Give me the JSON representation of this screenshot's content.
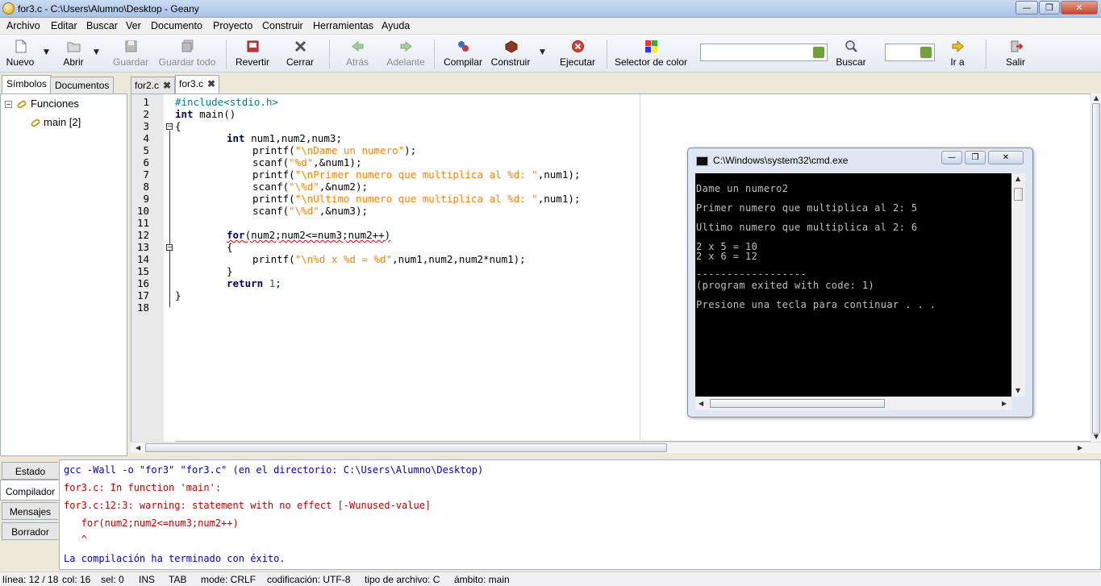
{
  "window": {
    "title": "for3.c - C:\\Users\\Alumno\\Desktop - Geany"
  },
  "menu": [
    "Archivo",
    "Editar",
    "Buscar",
    "Ver",
    "Documento",
    "Proyecto",
    "Construir",
    "Herramientas",
    "Ayuda"
  ],
  "toolbar": {
    "nuevo": "Nuevo",
    "abrir": "Abrir",
    "guardar": "Guardar",
    "guardar_todo": "Guardar todo",
    "revertir": "Revertir",
    "cerrar": "Cerrar",
    "atras": "Atrás",
    "adelante": "Adelante",
    "compilar": "Compilar",
    "construir": "Construir",
    "ejecutar": "Ejecutar",
    "selector_color": "Selector de color",
    "buscar": "Buscar",
    "ir_a": "Ir a",
    "salir": "Salir"
  },
  "sidebar": {
    "tabs": [
      "Símbolos",
      "Documentos"
    ],
    "tree": {
      "root": "Funciones",
      "child": "main [2]"
    }
  },
  "documents": [
    "for2.c",
    "for3.c"
  ],
  "editor": {
    "line_numbers": [
      "1",
      "2",
      "3",
      "4",
      "5",
      "6",
      "7",
      "8",
      "9",
      "10",
      "11",
      "12",
      "13",
      "14",
      "15",
      "16",
      "17",
      "18"
    ],
    "lines": {
      "l1": "#include<stdio.h>",
      "l2_kw": "int",
      "l2_rest": " main()",
      "l3": "{",
      "l4_kw": "int",
      "l4_rest": " num1,num2,num3;",
      "l5_a": "printf(",
      "l5_s": "\"\\nDame un numero\"",
      "l5_b": ");",
      "l6_a": "scanf(",
      "l6_s": "\"%d\"",
      "l6_b": ",&num1);",
      "l7_a": "printf(",
      "l7_s": "\"\\nPrimer numero que multiplica al %d: \"",
      "l7_b": ",num1);",
      "l8_a": "scanf(",
      "l8_s": "\"\\%d\"",
      "l8_b": ",&num2);",
      "l9_a": "printf(",
      "l9_s": "\"\\nUltimo numero que multiplica al %d: \"",
      "l9_b": ",num1);",
      "l10_a": "scanf(",
      "l10_s": "\"\\%d\"",
      "l10_b": ",&num3);",
      "l12_kw": "for",
      "l12_rest": "(num2;num2<=num3;num2++)",
      "l13": "{",
      "l14_a": "printf(",
      "l14_s": "\"\\n%d x %d = %d\"",
      "l14_b": ",num1,num2,num2*num1);",
      "l15": "}",
      "l16_kw": "return",
      "l16_num": "1",
      "l16_end": ";",
      "l17": "}"
    }
  },
  "console": {
    "title": "C:\\Windows\\system32\\cmd.exe",
    "lines": [
      "Dame un numero2",
      "Primer numero que multiplica al 2: 5",
      "Ultimo numero que multiplica al 2: 6",
      "2 x 5 = 10",
      "2 x 6 = 12",
      "------------------",
      "(program exited with code: 1)",
      "Presione una tecla para continuar . . ."
    ]
  },
  "bottom_tabs": [
    "Estado",
    "Compilador",
    "Mensajes",
    "Borrador"
  ],
  "compiler": {
    "cmd": "gcc -Wall -o \"for3\" \"for3.c\" (en el directorio: C:\\Users\\Alumno\\Desktop)",
    "l1": "for3.c: In function 'main':",
    "l2": "for3.c:12:3: warning: statement with no effect [-Wunused-value]",
    "l3": "   for(num2;num2<=num3;num2++)",
    "l4": "   ^",
    "l5": "La compilación ha terminado con éxito."
  },
  "colors": {
    "command": "#0000c0",
    "warning": "#c00000",
    "success": "#0000c0"
  },
  "statusbar": {
    "linea": "línea: 12 / 18",
    "col": "col: 16",
    "sel": "sel: 0",
    "ins": "INS",
    "tab": "TAB",
    "mode": "mode: CRLF",
    "cod": "codificación: UTF-8",
    "tipo": "tipo de archivo: C",
    "ambito": "ámbito: main"
  }
}
